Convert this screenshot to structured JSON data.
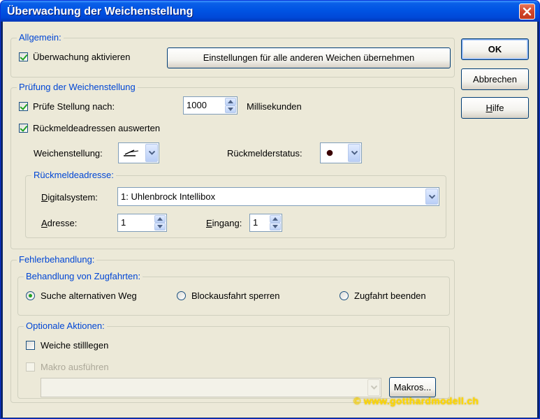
{
  "window": {
    "title": "Überwachung der Weichenstellung"
  },
  "allgemein": {
    "label": "Allgemein:",
    "monitor_checkbox_label": "Überwachung aktivieren",
    "monitor_checked": true,
    "apply_all_button": "Einstellungen für alle anderen Weichen übernehmen"
  },
  "pruefung": {
    "label": "Prüfung der Weichenstellung",
    "check_position_label": "Prüfe Stellung nach:",
    "check_position_checked": true,
    "delay_value": "1000",
    "delay_unit": "Millisekunden",
    "feedback_eval_label": "Rückmeldeadressen auswerten",
    "feedback_eval_checked": true,
    "switch_position_label": "Weichenstellung:",
    "feedback_status_label": "Rückmelderstatus:",
    "feedback_address": {
      "label": "Rückmeldeadresse:",
      "digital_system_label": "Digitalsystem:",
      "digital_system_value": "1: Uhlenbrock Intellibox",
      "address_label": "Adresse:",
      "address_value": "1",
      "input_label": "Eingang:",
      "input_value": "1"
    }
  },
  "fehler": {
    "label": "Fehlerbehandlung:",
    "routes": {
      "label": "Behandlung von Zugfahrten:",
      "options": [
        {
          "label": "Suche alternativen Weg",
          "checked": true
        },
        {
          "label": "Blockausfahrt sperren",
          "checked": false
        },
        {
          "label": "Zugfahrt beenden",
          "checked": false
        }
      ]
    },
    "optional": {
      "label": "Optionale Aktionen:",
      "disable_switch_label": "Weiche stilllegen",
      "disable_switch_checked": false,
      "run_macro_label": "Makro ausführen",
      "run_macro_checked": false,
      "macro_value": "",
      "macros_button": "Makros..."
    }
  },
  "buttons": {
    "ok": "OK",
    "cancel": "Abbrechen",
    "help": "Hilfe"
  },
  "watermark": "© www.gotthardmodell.ch",
  "colors": {
    "title_bar": "#0054e3",
    "group_label": "#0046d5",
    "check_mark": "#21a121",
    "watermark": "#ffd700"
  }
}
